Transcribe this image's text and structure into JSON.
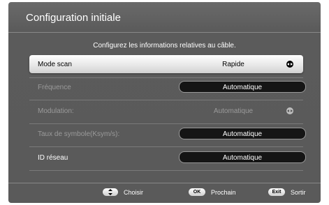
{
  "header": {
    "title": "Configuration initiale"
  },
  "subtitle": "Configurez les informations relatives au câble.",
  "rows": [
    {
      "label": "Mode scan",
      "value": "Rapide",
      "state": "selected",
      "control": "arrows"
    },
    {
      "label": "Fréquence",
      "value": "Automatique",
      "state": "disabled",
      "control": "pill"
    },
    {
      "label": "Modulation:",
      "value": "Automatique",
      "state": "disabled",
      "control": "arrows"
    },
    {
      "label": "Taux de symbole(Ksym/s):",
      "value": "Automatique",
      "state": "disabled",
      "control": "pill"
    },
    {
      "label": "ID réseau",
      "value": "Automatique",
      "state": "normal",
      "control": "pill"
    }
  ],
  "footer": {
    "choose": {
      "key": "",
      "label": "Choisir",
      "icon": "up-down-arrows-icon"
    },
    "next": {
      "key": "OK",
      "label": "Prochain"
    },
    "exit": {
      "key": "Exit",
      "label": "Sortir"
    }
  },
  "colors": {
    "panel": "#5b5b5b",
    "selected_row": "#e6e6e6",
    "pill": "#151515",
    "disabled_text": "#9a9a9a"
  }
}
